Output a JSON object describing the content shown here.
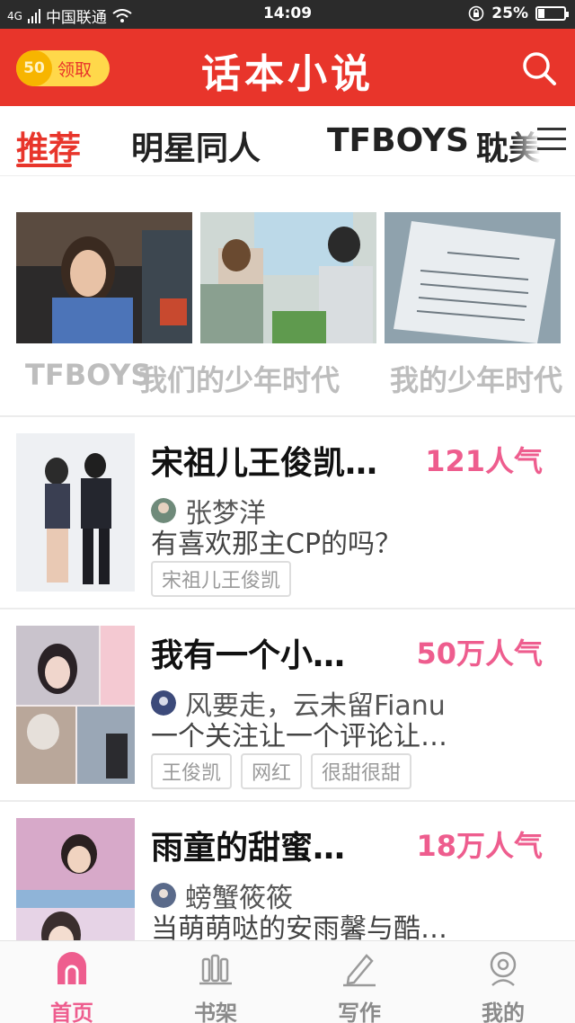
{
  "status_bar": {
    "network": "4G",
    "carrier": "中国联通",
    "time": "14:09",
    "battery_percent": "25%",
    "battery_level": 0.25
  },
  "header": {
    "coin_value": "50",
    "claim_label": "领取",
    "app_title": "话本小说",
    "icons": {
      "search": "search-icon"
    }
  },
  "tabs": {
    "items": [
      "推荐",
      "明星同人",
      "TFBOYS",
      "耽美"
    ],
    "active_index": 0
  },
  "topics": [
    {
      "label": "TFBOYS"
    },
    {
      "label": "我们的少年时代"
    },
    {
      "label": "我的少年时代"
    }
  ],
  "novels": [
    {
      "title": "宋祖儿王俊凯…",
      "popularity": "121人气",
      "author": "张梦洋",
      "description": "有喜欢那主CP的吗？",
      "tags": [
        "宋祖儿王俊凯"
      ]
    },
    {
      "title": "我有一个小…",
      "popularity": "50万人气",
      "author": "风要走，云未留Fianu",
      "description": "一个关注让一个评论让…",
      "tags": [
        "王俊凯",
        "网红",
        "很甜很甜"
      ]
    },
    {
      "title": "雨童的甜蜜…",
      "popularity": "18万人气",
      "author": "螃蟹筱筱",
      "description": "当萌萌哒的安雨馨与酷…",
      "tags": []
    }
  ],
  "bottom_nav": {
    "items": [
      {
        "label": "首页",
        "icon": "home-icon"
      },
      {
        "label": "书架",
        "icon": "bookshelf-icon"
      },
      {
        "label": "写作",
        "icon": "pen-icon"
      },
      {
        "label": "我的",
        "icon": "profile-icon"
      }
    ],
    "active_index": 0
  },
  "colors": {
    "brand_red": "#e8352b",
    "popularity_pink": "#ee5d8e",
    "coin_yellow": "#ffd84a"
  }
}
